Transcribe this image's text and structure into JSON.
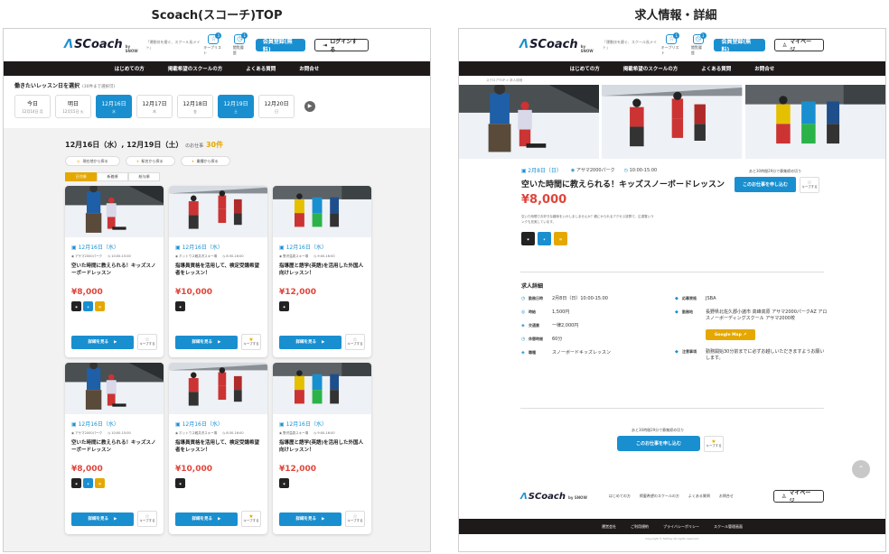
{
  "captions": {
    "left": "Scoach(スコーチ)TOP",
    "right": "求人情報・詳細"
  },
  "header": {
    "logo_prefix": "Λ",
    "logo_main": "SCoach",
    "logo_sub": "by SNOW",
    "tagline": "「運動技を磨ぐ、スクール長メイト」",
    "favorites_label": "キープリスト",
    "favorites_count": "1",
    "history_label": "閲覧履歴",
    "history_count": "1",
    "register_label": "会員登録(無料)",
    "login_label": "ログインする",
    "mypage_label": "マイページ"
  },
  "nav": [
    "はじめての方",
    "掲載希望のスクールの方",
    "よくある質問",
    "お問合せ"
  ],
  "datepicker": {
    "title": "働きたいレッスン日を選択",
    "hint": "(30件まで選択可)",
    "days": [
      {
        "label": "今日",
        "sub": "12月14日 月",
        "selected": false
      },
      {
        "label": "明日",
        "sub": "12月15日 火",
        "selected": false
      },
      {
        "label": "12月16日",
        "sub": "水",
        "selected": true
      },
      {
        "label": "12月17日",
        "sub": "木",
        "selected": false
      },
      {
        "label": "12月18日",
        "sub": "金",
        "selected": false
      },
      {
        "label": "12月19日",
        "sub": "土",
        "selected": true
      },
      {
        "label": "12月20日",
        "sub": "日",
        "selected": false
      }
    ]
  },
  "results": {
    "dates": "12月16日（水）, 12月19日（土）",
    "suffix": "のお仕事",
    "count": "30件"
  },
  "filters": [
    "現在地から探る",
    "駅名から探る",
    "業種から探る"
  ],
  "sort_tabs": [
    "日付順",
    "新着順",
    "給与順"
  ],
  "cards": [
    {
      "date": "12月16日（水）",
      "place": "アサマ2000パーク",
      "time": "10:00-15:00",
      "title": "空いた時間に教えられる！キッズスノーボードレッスン",
      "price": "¥8,000",
      "badges": [
        "k",
        "b",
        "y"
      ],
      "kept": false,
      "photo": 1
    },
    {
      "date": "12月16日（水）",
      "place": "ホットウス軽井沢スキー場",
      "time": "8:30-16:00",
      "title": "指導員資格を活用して、検定受講希望者をレッスン！",
      "price": "¥10,000",
      "badges": [
        "k"
      ],
      "kept": true,
      "photo": 2
    },
    {
      "date": "12月16日（水）",
      "place": "野沢温泉スキー場",
      "time": "9:00-16:00",
      "title": "指導歴と語学(英語)を活用した外国人向けレッスン！",
      "price": "¥12,000",
      "badges": [
        "k"
      ],
      "kept": false,
      "photo": 3
    },
    {
      "date": "12月16日（水）",
      "place": "アサマ2000パーク",
      "time": "10:00-15:00",
      "title": "空いた時間に教えられる！キッズスノーボードレッスン",
      "price": "¥8,000",
      "badges": [
        "k",
        "b",
        "y"
      ],
      "kept": false,
      "photo": 1
    },
    {
      "date": "12月16日（水）",
      "place": "ホットウス軽井沢スキー場",
      "time": "8:30-16:00",
      "title": "指導員資格を活用して、検定受講希望者をレッスン！",
      "price": "¥10,000",
      "badges": [
        "k"
      ],
      "kept": true,
      "photo": 2
    },
    {
      "date": "12月16日（水）",
      "place": "野沢温泉スキー場",
      "time": "9:00-16:00",
      "title": "指導歴と語学(英語)を活用した外国人向けレッスン！",
      "price": "¥12,000",
      "badges": [
        "k"
      ],
      "kept": false,
      "photo": 3
    }
  ],
  "card_detail_label": "詳細を見る",
  "keep_label": "キープする",
  "detail": {
    "breadcrumb": "スクロアTOP > 求人詳細",
    "date": "2月8日（日）",
    "place": "アサマ2000パーク",
    "time": "10:00-15:00",
    "title": "空いた時間に教えられる！キッズスノーボードレッスン",
    "price": "¥8,000",
    "desc": "空いた時間でお好きな趣味をいかしましませんか？親にかられるアクセス抜群で、広漠雪いランクも充実しています。",
    "apply_note": "あと30時間29分で募集締め切り",
    "apply_label": "このお仕事を申し込む",
    "section_title": "求人詳細",
    "rows_left": [
      {
        "k": "勤務日時",
        "v": "2月8日（日）10:00-15:00"
      },
      {
        "k": "時給",
        "v": "1,500円"
      },
      {
        "k": "交通費",
        "v": "一律2,000円"
      },
      {
        "k": "休憩時間",
        "v": "60分"
      },
      {
        "k": "職種",
        "v": "スノーボードキッズレッスン"
      }
    ],
    "rows_right": [
      {
        "k": "応募資格",
        "v": "JSBA"
      },
      {
        "k": "勤務地",
        "v": "長野県北佐久郡小諸市 高峰高原 アサマ2000パークAZ アロスノーボーディングスクール アサマ2000校"
      },
      {
        "k": "注意事項",
        "v": "勤務開始30分前までに必ずお越しいただきますようお願いします。"
      }
    ],
    "map_label": "Google Map"
  },
  "footer": {
    "links": [
      "はじめての方",
      "掲載希望のスクールの方",
      "よくある質問",
      "お問合せ"
    ],
    "bar": [
      "運営会社",
      "ご利用規約",
      "プライバシーポリシー",
      "スクール管理画面"
    ],
    "copyright": "Copyright © SkiPlay All rights reserved."
  }
}
